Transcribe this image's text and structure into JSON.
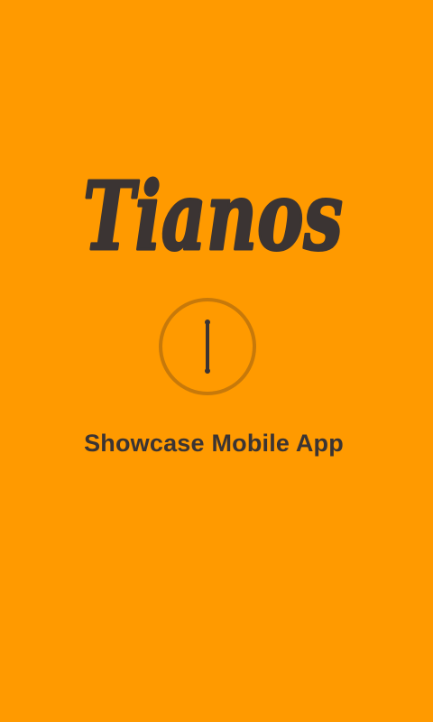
{
  "app": {
    "logo_text": "Tianos",
    "tagline": "Showcase Mobile App",
    "background_color": "#ff9a00",
    "text_color": "#3b3433",
    "spinner_ring_color": "#c7790a"
  },
  "loading_indicator": {
    "icon": "loading-spinner-icon"
  }
}
